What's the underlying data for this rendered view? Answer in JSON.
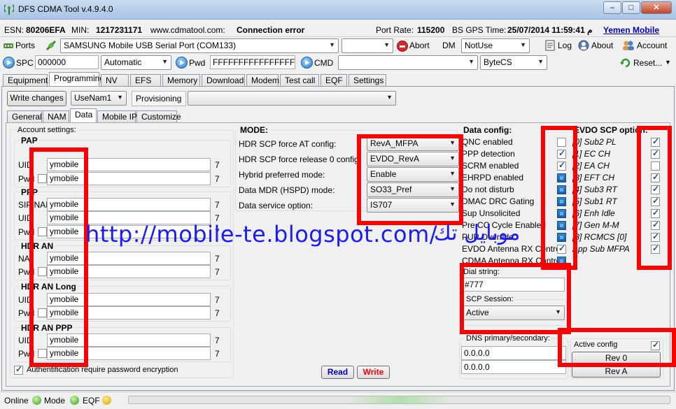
{
  "window": {
    "title": "DFS CDMA Tool v.4.9.4.0"
  },
  "info_bar": {
    "esn_label": "ESN:",
    "esn_value": "80206EFA",
    "min_label": "MIN:",
    "min_value": "1217231171",
    "website": "www.cdmatool.com:",
    "status": "Connection error",
    "port_rate_label": "Port Rate:",
    "port_rate_value": "115200",
    "gps_label": "BS GPS Time:",
    "gps_value": "25/07/2014 11:59:41 م",
    "carrier_link": "Yemen Mobile"
  },
  "toolbar1": {
    "ports_label": "Ports",
    "port_select": "SAMSUNG Mobile USB Serial Port  (COM133)",
    "abort_label": "Abort",
    "dm_label": "DM",
    "dm_select": "NotUse",
    "log_label": "Log",
    "about_label": "About",
    "account_label": "Account"
  },
  "toolbar2": {
    "spc_label": "SPC",
    "spc_value": "000000",
    "spc_mode": "Automatic",
    "pwd_label": "Pwd",
    "pwd_value": "FFFFFFFFFFFFFFFF",
    "cmd_label": "CMD",
    "cmd_value": "",
    "encoding": "ByteCS",
    "reset_label": "Reset..."
  },
  "main_tabs": [
    "Equipment",
    "Programming",
    "NV",
    "EFS",
    "Memory",
    "Download",
    "Modem",
    "Test call",
    "EQF",
    "Settings"
  ],
  "programming": {
    "write_changes": "Write changes",
    "nam_select": "UseNam1",
    "provisioning_label": "Provisioning",
    "provisioning_value": ""
  },
  "sub_tabs": [
    "General",
    "NAM",
    "Data",
    "Mobile IP",
    "Customize"
  ],
  "account_settings": {
    "title": "Account settings:",
    "groups": [
      {
        "title": "PAP",
        "rows": [
          {
            "label": "UID",
            "value": "ymobile",
            "len": "7",
            "check": false
          },
          {
            "label": "Pwd",
            "value": "ymobile",
            "len": "7",
            "check": true
          }
        ]
      },
      {
        "title": "PPP",
        "rows": [
          {
            "label": "SIP NAI",
            "value": "ymobile",
            "len": "7",
            "check": false
          },
          {
            "label": "UID",
            "value": "ymobile",
            "len": "7",
            "check": false
          },
          {
            "label": "Pwd",
            "value": "ymobile",
            "len": "7",
            "check": true
          }
        ]
      },
      {
        "title": "HDR AN",
        "rows": [
          {
            "label": "NAI",
            "value": "ymobile",
            "len": "7",
            "check": false
          },
          {
            "label": "Pwd",
            "value": "ymobile",
            "len": "7",
            "check": true
          }
        ]
      },
      {
        "title": "HDR AN Long",
        "rows": [
          {
            "label": "UID",
            "value": "ymobile",
            "len": "7",
            "check": false
          },
          {
            "label": "Pwd",
            "value": "ymobile",
            "len": "7",
            "check": true
          }
        ]
      },
      {
        "title": "HDR AN PPP",
        "rows": [
          {
            "label": "UID",
            "value": "ymobile",
            "len": "7",
            "check": false
          },
          {
            "label": "Pwd",
            "value": "ymobile",
            "len": "7",
            "check": true
          }
        ]
      }
    ],
    "auth_check_label": "Authentification require password encryption"
  },
  "mode": {
    "title": "MODE:",
    "rows": [
      {
        "label": "HDR SCP force AT config:",
        "value": "RevA_MFPA"
      },
      {
        "label": "HDR SCP force release 0 config:",
        "value": "EVDO_RevA"
      },
      {
        "label": "Hybrid preferred mode:",
        "value": "Enable"
      },
      {
        "label": "Data MDR (HSPD) mode:",
        "value": "SO33_Pref"
      },
      {
        "label": "Data service option:",
        "value": "IS707"
      }
    ]
  },
  "buttons": {
    "read": "Read",
    "write": "Write"
  },
  "data_config": {
    "title": "Data config:",
    "items": [
      {
        "label": "QNC enabled",
        "state": "off"
      },
      {
        "label": "PPP detection",
        "state": "on"
      },
      {
        "label": "SCRM enabled",
        "state": "on"
      },
      {
        "label": "EHRPD enabled",
        "state": "blue"
      },
      {
        "label": "Do not disturb",
        "state": "blue"
      },
      {
        "label": "DMAC DRC Gating",
        "state": "blue"
      },
      {
        "label": "Sup Unsolicited",
        "state": "blue"
      },
      {
        "label": "Pre CC Cycle Enabled",
        "state": "blue"
      },
      {
        "label": "PUP Override",
        "state": "blue"
      },
      {
        "label": "EVDO Antenna RX Control",
        "state": "on"
      },
      {
        "label": "CDMA Antenna RX Control",
        "state": "blue"
      }
    ],
    "dial_label": "Dial string:",
    "dial_value": "#777",
    "scp_session_label": "SCP Session:",
    "scp_session_value": "Active",
    "dns_label": "DNS primary/secondary:",
    "dns_primary": "0.0.0.0",
    "dns_secondary": "0.0.0.0"
  },
  "evdo_scp": {
    "title": "EVDO SCP option:",
    "items": [
      {
        "label": "[0] Sub2 PL",
        "state": "on"
      },
      {
        "label": "[1] EC CH",
        "state": "on"
      },
      {
        "label": "[2] EA CH",
        "state": "off"
      },
      {
        "label": "[3] EFT CH",
        "state": "on"
      },
      {
        "label": "[4] Sub3 RT",
        "state": "on"
      },
      {
        "label": "[5] Sub1 RT",
        "state": "on"
      },
      {
        "label": "[6] Enh Idle",
        "state": "on"
      },
      {
        "label": "[7] Gen M-M",
        "state": "on"
      },
      {
        "label": "[8] RCMCS [0]",
        "state": "on"
      },
      {
        "label": "App Sub MFPA",
        "state": "on"
      }
    ],
    "active_config_label": "Active config",
    "rev0": "Rev 0",
    "revA": "Rev A"
  },
  "watermark": {
    "url": "http://mobile-te.blogspot.com/",
    "arabic": "موبايل تك"
  },
  "statusbar": {
    "online": "Online",
    "mode": "Mode",
    "eqf": "EQF"
  },
  "colors": {
    "highlight_red": "#ff0000",
    "link_blue": "#0000cc",
    "watermark_blue": "#1a1aff"
  }
}
